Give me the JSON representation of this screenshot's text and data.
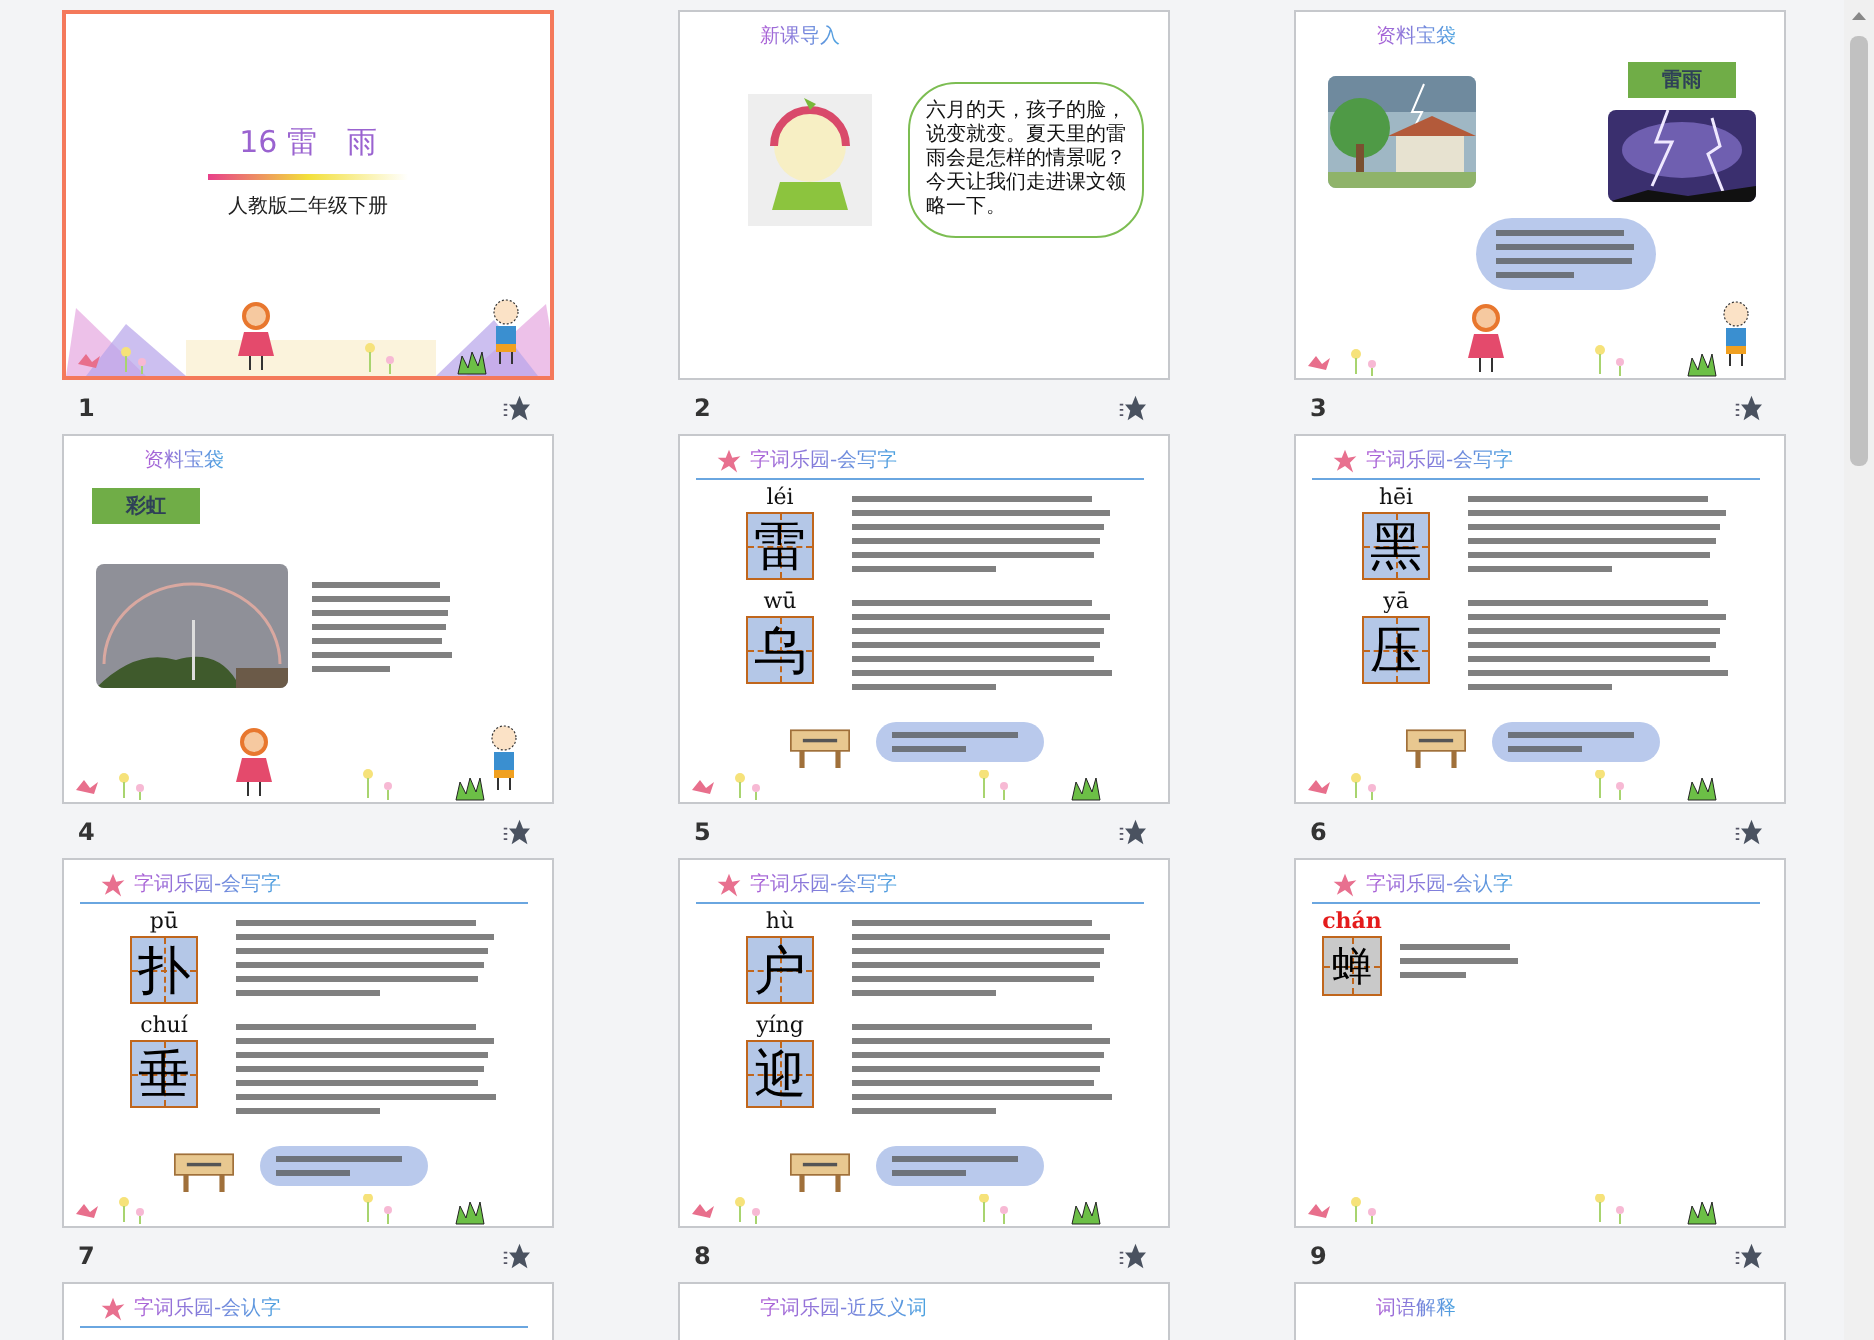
{
  "slides": [
    {
      "number": "1",
      "selected": true,
      "kind": "title",
      "title": "16 雷　雨",
      "subtitle": "人教版二年级下册"
    },
    {
      "number": "2",
      "selected": false,
      "kind": "intro",
      "heading": "新课导入",
      "bubble": "六月的天，孩子的脸，说变就变。夏天里的雷雨会是怎样的情景呢？今天让我们走进课文领略一下。"
    },
    {
      "number": "3",
      "selected": false,
      "kind": "info",
      "heading": "资料宝袋",
      "tag": "雷雨"
    },
    {
      "number": "4",
      "selected": false,
      "kind": "info-text",
      "heading": "资料宝袋",
      "tag": "彩虹"
    },
    {
      "number": "5",
      "selected": false,
      "kind": "writing",
      "heading": "字词乐园-会写字",
      "chars": [
        {
          "pinyin": "léi",
          "char": "雷"
        },
        {
          "pinyin": "wū",
          "char": "乌"
        }
      ]
    },
    {
      "number": "6",
      "selected": false,
      "kind": "writing",
      "heading": "字词乐园-会写字",
      "chars": [
        {
          "pinyin": "hēi",
          "char": "黑"
        },
        {
          "pinyin": "yā",
          "char": "压"
        }
      ]
    },
    {
      "number": "7",
      "selected": false,
      "kind": "writing",
      "heading": "字词乐园-会写字",
      "chars": [
        {
          "pinyin": "pū",
          "char": "扑"
        },
        {
          "pinyin": "chuí",
          "char": "垂"
        }
      ]
    },
    {
      "number": "8",
      "selected": false,
      "kind": "writing",
      "heading": "字词乐园-会写字",
      "chars": [
        {
          "pinyin": "hù",
          "char": "户"
        },
        {
          "pinyin": "yíng",
          "char": "迎"
        }
      ]
    },
    {
      "number": "9",
      "selected": false,
      "kind": "recognize",
      "heading": "字词乐园-会认字",
      "chars": [
        {
          "pinyin": "chán",
          "char": "蝉"
        }
      ]
    },
    {
      "selected": false,
      "kind": "partial",
      "heading": "字词乐园-会认字",
      "header_icon": true
    },
    {
      "selected": false,
      "kind": "partial",
      "heading": "字词乐园-近反义词",
      "header_icon": false
    },
    {
      "selected": false,
      "kind": "partial",
      "heading": "词语解释",
      "header_icon": false
    }
  ]
}
